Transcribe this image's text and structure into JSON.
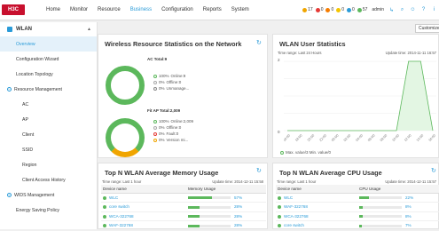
{
  "topbar": {
    "logo": "H3C",
    "nav": [
      "Home",
      "Monitor",
      "Resource",
      "Business",
      "Configuration",
      "Reports",
      "System"
    ],
    "active_nav": "Business",
    "alarms": [
      {
        "count": "17",
        "color": "#f0a500"
      },
      {
        "count": "0",
        "color": "#e53935"
      },
      {
        "count": "0",
        "color": "#f57c00"
      },
      {
        "count": "0",
        "color": "#f5c400"
      },
      {
        "count": "0",
        "color": "#2a9bd8"
      },
      {
        "count": "57",
        "color": "#5cb85c"
      }
    ],
    "user": "admin"
  },
  "sidebar": {
    "title": "WLAN",
    "items": [
      {
        "label": "Overview",
        "level": "l1",
        "active": true
      },
      {
        "label": "Configuration Wizard",
        "level": "l1"
      },
      {
        "label": "Location Topology",
        "level": "l1"
      },
      {
        "label": "Resource Management",
        "level": "group"
      },
      {
        "label": "AC",
        "level": "l2"
      },
      {
        "label": "AP",
        "level": "l2"
      },
      {
        "label": "Client",
        "level": "l2"
      },
      {
        "label": "SSID",
        "level": "l2"
      },
      {
        "label": "Region",
        "level": "l2"
      },
      {
        "label": "Client Access History",
        "level": "l2"
      },
      {
        "label": "WIDS Management",
        "level": "group"
      },
      {
        "label": "Energy Saving Policy",
        "level": "l1"
      }
    ]
  },
  "customize": "Customize",
  "resource_panel": {
    "title": "Wireless Resource Statistics on the Network",
    "ac_total": "AC Total:9",
    "ac_legend": [
      {
        "pct": "100%",
        "label": "Online:9"
      },
      {
        "pct": "0%",
        "label": "Offline:0"
      },
      {
        "pct": "0%",
        "label": "Unmanage..."
      }
    ],
    "fit_total": "Fit AP Total:2,009",
    "fit_legend": [
      {
        "pct": "100%",
        "label": "Online:2,009"
      },
      {
        "pct": "0%",
        "label": "Offline:0"
      },
      {
        "pct": "0%",
        "label": "Fault:0"
      },
      {
        "pct": "0%",
        "label": "Version mi..."
      }
    ]
  },
  "user_panel": {
    "title": "WLAN User Statistics",
    "time_range": "Time range: Last 24 Hours",
    "update": "Update time: 2014-11-11 16:57",
    "y_top": "2",
    "y_bottom": "0",
    "legend": "Max. value/3 Min. value/0",
    "chart_data": {
      "type": "line",
      "x": [
        "16:00",
        "18:00",
        "20:00",
        "22:00",
        "00:00",
        "02:00",
        "04:00",
        "06:00",
        "08:00",
        "10:00",
        "12:00",
        "14:00",
        "16:00"
      ],
      "values": [
        0,
        0,
        0,
        0,
        0,
        0,
        0,
        0,
        0,
        0,
        2,
        2,
        0
      ],
      "ylim": [
        0,
        2
      ]
    }
  },
  "memory_panel": {
    "title": "Top N WLAN Average Memory Usage",
    "time_range": "Time range: Last 1 hour",
    "update": "Update time: 2014-12-11 15:58",
    "headers": [
      "Device name",
      "Memory Usage"
    ],
    "rows": [
      {
        "name": "WLC",
        "usage": 57,
        "label": "57%"
      },
      {
        "name": "core switch",
        "usage": 28,
        "label": "28%"
      },
      {
        "name": "WCA-322768",
        "usage": 28,
        "label": "28%"
      },
      {
        "name": "WAF-322768",
        "usage": 28,
        "label": "28%"
      }
    ]
  },
  "cpu_panel": {
    "title": "Top N WLAN Average CPU Usage",
    "time_range": "Time range: Last 1 hour",
    "update": "Update time: 2014-12-11 15:57",
    "headers": [
      "Device name",
      "CPU Usage"
    ],
    "rows": [
      {
        "name": "WLC",
        "usage": 22,
        "label": "22%"
      },
      {
        "name": "WAF-322768",
        "usage": 8,
        "label": "8%"
      },
      {
        "name": "WCA-322768",
        "usage": 8,
        "label": "8%"
      },
      {
        "name": "core switch",
        "usage": 7,
        "label": "7%"
      }
    ]
  }
}
